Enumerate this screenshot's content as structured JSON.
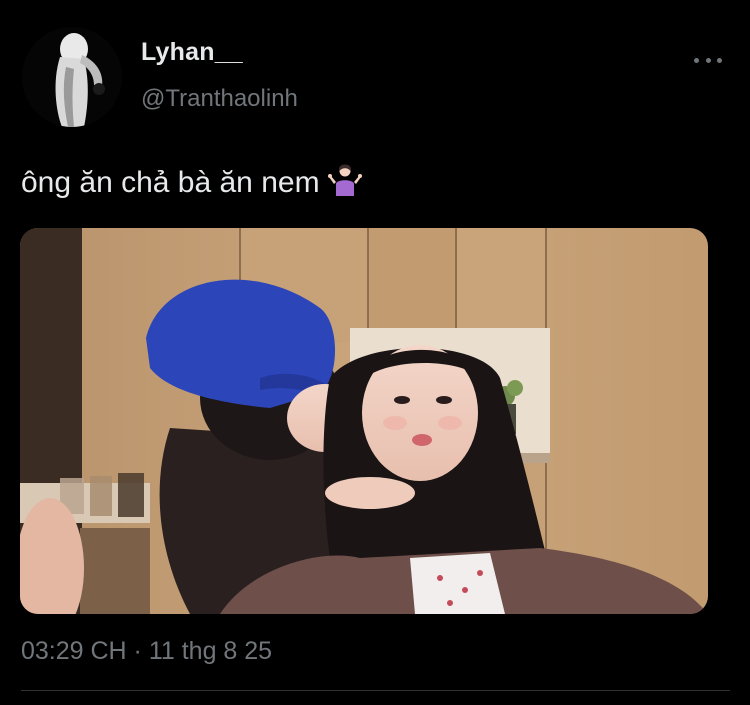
{
  "tweet": {
    "author": {
      "display_name": "Lyhan__",
      "handle": "@Tranthaolinh",
      "avatar_icon": "profile-avatar"
    },
    "text": "ông ăn chả bà ăn nem",
    "emoji_icon": "person-shrugging-emoji",
    "media": {
      "type": "photo",
      "icon": "tweet-photo"
    },
    "timestamp": "03:29 CH · 11 thg 8 25",
    "more_icon": "more-options-icon"
  },
  "colors": {
    "background": "#000000",
    "primary_text": "#e7e9ea",
    "secondary_text": "#71767b",
    "divider": "#2f3336"
  }
}
